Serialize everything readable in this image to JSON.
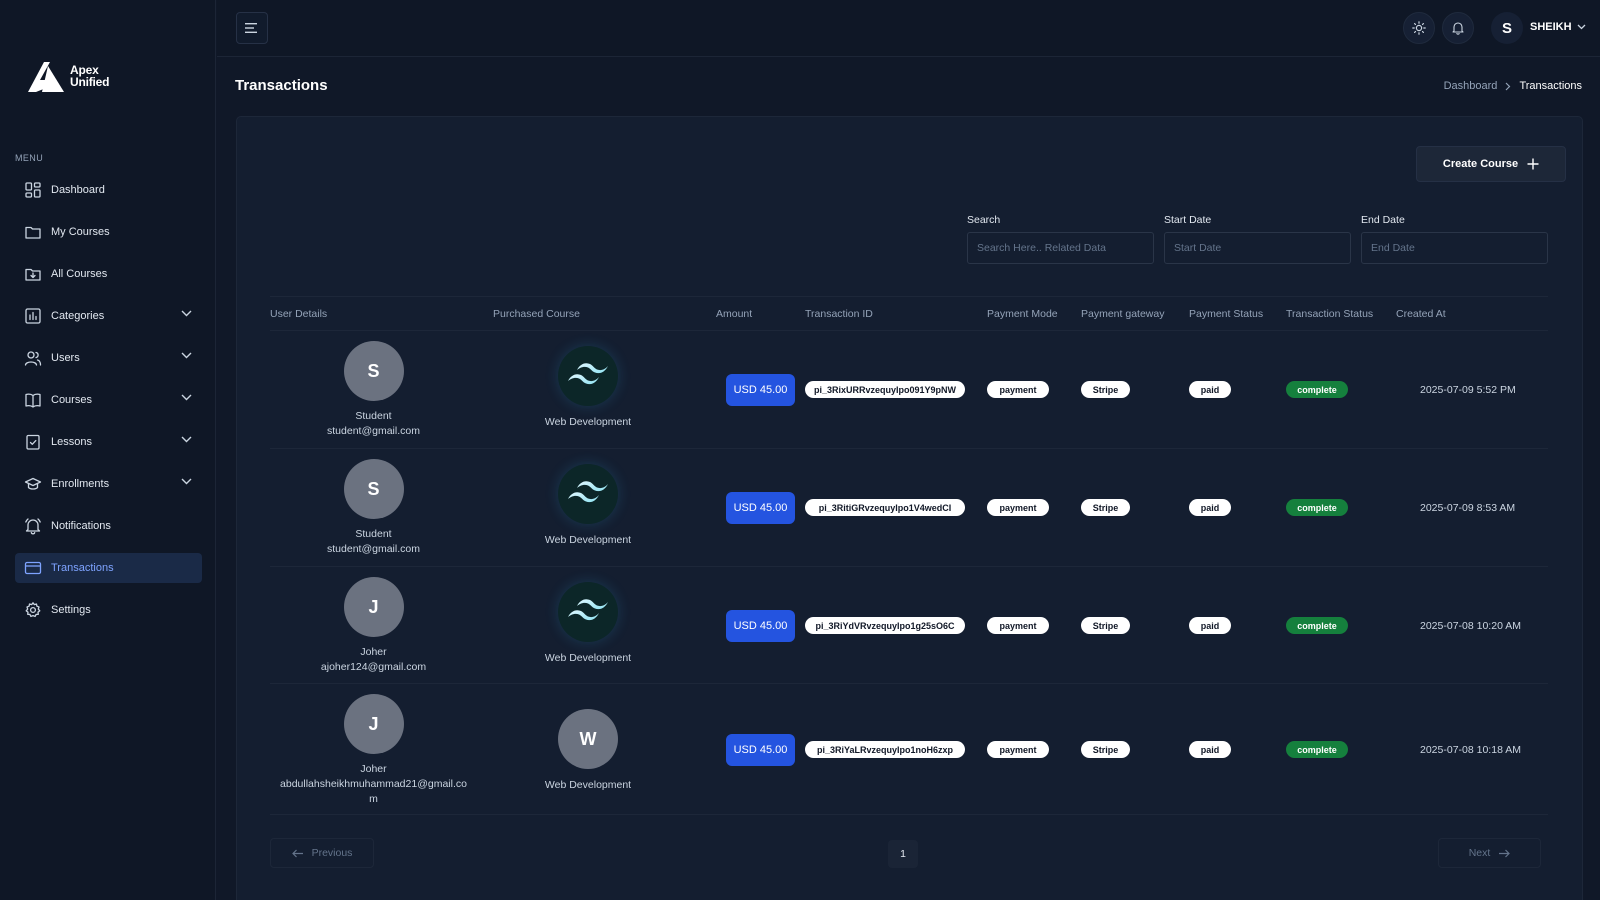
{
  "brand": {
    "line1": "Apex",
    "line2": "Unified"
  },
  "sidebar": {
    "menu_heading": "MENU",
    "items": [
      {
        "label": "Dashboard",
        "icon": "dashboard-grid-icon",
        "expandable": false
      },
      {
        "label": "My Courses",
        "icon": "folder-icon",
        "expandable": false
      },
      {
        "label": "All Courses",
        "icon": "folder-download-icon",
        "expandable": false
      },
      {
        "label": "Categories",
        "icon": "bar-chart-icon",
        "expandable": true
      },
      {
        "label": "Users",
        "icon": "users-icon",
        "expandable": true
      },
      {
        "label": "Courses",
        "icon": "book-open-icon",
        "expandable": true
      },
      {
        "label": "Lessons",
        "icon": "clipboard-check-icon",
        "expandable": true
      },
      {
        "label": "Enrollments",
        "icon": "graduation-cap-icon",
        "expandable": true
      },
      {
        "label": "Notifications",
        "icon": "bell-icon",
        "expandable": false
      },
      {
        "label": "Transactions",
        "icon": "credit-card-icon",
        "expandable": false,
        "active": true
      },
      {
        "label": "Settings",
        "icon": "gear-icon",
        "expandable": false
      }
    ]
  },
  "header": {
    "avatar_letter": "S",
    "user_name": "SHEIKH"
  },
  "page": {
    "title": "Transactions",
    "breadcrumb": {
      "parent": "Dashboard",
      "current": "Transactions"
    }
  },
  "toolbar": {
    "create_label": "Create Course"
  },
  "filters": {
    "search": {
      "label": "Search",
      "placeholder": "Search Here.. Related Data"
    },
    "start_date": {
      "label": "Start Date",
      "placeholder": "Start Date"
    },
    "end_date": {
      "label": "End Date",
      "placeholder": "End Date"
    }
  },
  "table": {
    "columns": [
      "User Details",
      "Purchased Course",
      "Amount",
      "Transaction ID",
      "Payment Mode",
      "Payment gateway",
      "Payment Status",
      "Transaction Status",
      "Created At"
    ],
    "rows": [
      {
        "avatar": "S",
        "name": "Student",
        "email": "student@gmail.com",
        "course_logo": "tailwind",
        "course_letter": "",
        "course": "Web Development",
        "amount": "USD 45.00",
        "transaction_id": "pi_3RixURRvzequyIpo091Y9pNW",
        "mode": "payment",
        "gateway": "Stripe",
        "payment_status": "paid",
        "transaction_status": "complete",
        "created_at": "2025-07-09 5:52 PM"
      },
      {
        "avatar": "S",
        "name": "Student",
        "email": "student@gmail.com",
        "course_logo": "tailwind",
        "course_letter": "",
        "course": "Web Development",
        "amount": "USD 45.00",
        "transaction_id": "pi_3RitiGRvzequyIpo1V4wedCI",
        "mode": "payment",
        "gateway": "Stripe",
        "payment_status": "paid",
        "transaction_status": "complete",
        "created_at": "2025-07-09 8:53 AM"
      },
      {
        "avatar": "J",
        "name": "Joher",
        "email": "ajoher124@gmail.com",
        "course_logo": "tailwind",
        "course_letter": "",
        "course": "Web Development",
        "amount": "USD 45.00",
        "transaction_id": "pi_3RiYdVRvzequyIpo1g25sO6C",
        "mode": "payment",
        "gateway": "Stripe",
        "payment_status": "paid",
        "transaction_status": "complete",
        "created_at": "2025-07-08 10:20 AM"
      },
      {
        "avatar": "J",
        "name": "Joher",
        "email": "abdullahsheikhmuhammad21@gmail.com",
        "course_logo": "letter",
        "course_letter": "W",
        "course": "Web Development",
        "amount": "USD 45.00",
        "transaction_id": "pi_3RiYaLRvzequyIpo1noH6zxp",
        "mode": "payment",
        "gateway": "Stripe",
        "payment_status": "paid",
        "transaction_status": "complete",
        "created_at": "2025-07-08 10:18 AM"
      }
    ]
  },
  "pagination": {
    "previous_label": "Previous",
    "current_page": "1",
    "next_label": "Next"
  },
  "colors": {
    "accent": "#2454e0",
    "success": "#15803d",
    "active_nav": "#7ea3ff"
  }
}
